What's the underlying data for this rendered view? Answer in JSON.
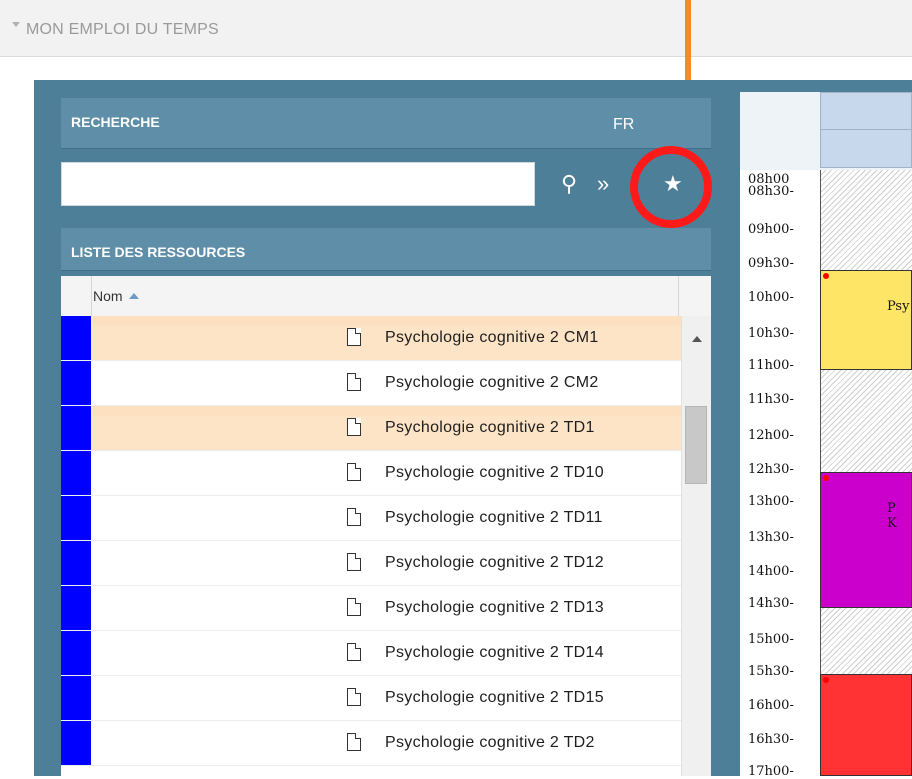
{
  "header": {
    "title": "MON EMPLOI DU TEMPS"
  },
  "search": {
    "title": "RECHERCHE",
    "lang": "FR",
    "input_value": "",
    "icons": [
      "search-icon",
      "expand-icon",
      "star-icon"
    ],
    "annotation_color": "#ff1a1a"
  },
  "resources": {
    "title": "LISTE DES RESSOURCES",
    "col_header": "Nom",
    "rows": [
      {
        "label": "Psychologie cognitive 2 CM1",
        "selected": true
      },
      {
        "label": "Psychologie cognitive 2 CM2",
        "selected": false
      },
      {
        "label": "Psychologie cognitive 2 TD1",
        "selected": true
      },
      {
        "label": "Psychologie cognitive 2 TD10",
        "selected": false
      },
      {
        "label": "Psychologie cognitive 2 TD11",
        "selected": false
      },
      {
        "label": "Psychologie cognitive 2 TD12",
        "selected": false
      },
      {
        "label": "Psychologie cognitive 2 TD13",
        "selected": false
      },
      {
        "label": "Psychologie cognitive 2 TD14",
        "selected": false
      },
      {
        "label": "Psychologie cognitive 2 TD15",
        "selected": false
      },
      {
        "label": "Psychologie cognitive 2 TD2",
        "selected": false
      }
    ],
    "row_color": "#0000ff"
  },
  "calendar": {
    "times": [
      "08h00",
      "08h30-",
      "09h00-",
      "09h30-",
      "10h00-",
      "10h30-",
      "11h00-",
      "11h30-",
      "12h00-",
      "12h30-",
      "13h00-",
      "13h30-",
      "14h00-",
      "14h30-",
      "15h00-",
      "15h30-",
      "16h00-",
      "16h30-",
      "17h00-"
    ],
    "events": [
      {
        "text": "Psy",
        "color": "#ffe566"
      },
      {
        "text": "P\nK",
        "color": "#cc00cc"
      },
      {
        "text": "",
        "color": "#ff3333"
      }
    ]
  }
}
